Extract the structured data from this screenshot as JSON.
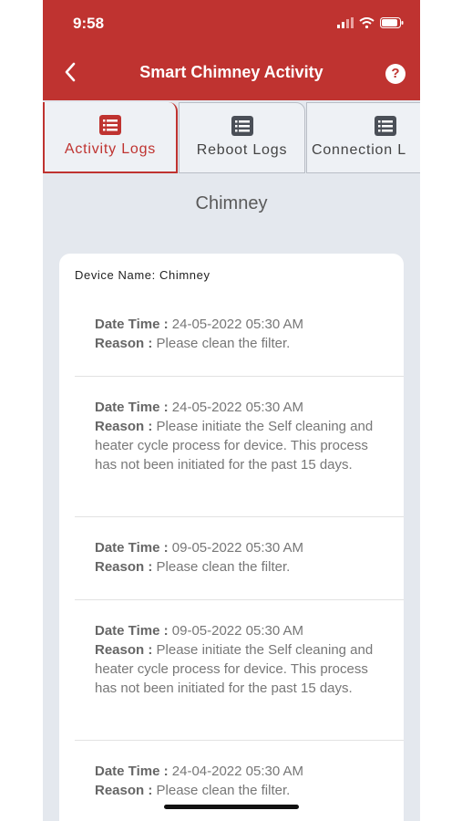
{
  "status_bar": {
    "time": "9:58"
  },
  "header": {
    "title": "Smart Chimney Activity",
    "help_label": "?"
  },
  "tabs": [
    {
      "label": "Activity Logs"
    },
    {
      "label": "Reboot Logs"
    },
    {
      "label": "Connection L"
    }
  ],
  "section_title": "Chimney",
  "device": {
    "label": "Device Name: Chimney"
  },
  "log_entries": [
    {
      "date_label": "Date Time :",
      "date": "24-05-2022 05:30 AM",
      "reason_label": "Reason :",
      "reason": "Please clean the filter."
    },
    {
      "date_label": "Date Time :",
      "date": "24-05-2022 05:30 AM",
      "reason_label": "Reason :",
      "reason": "Please initiate the Self cleaning and heater cycle process for device. This process has not been initiated for the past 15 days."
    },
    {
      "date_label": "Date Time :",
      "date": "09-05-2022 05:30 AM",
      "reason_label": "Reason :",
      "reason": "Please clean the filter."
    },
    {
      "date_label": "Date Time :",
      "date": "09-05-2022 05:30 AM",
      "reason_label": "Reason :",
      "reason": "Please initiate the Self cleaning and heater cycle process for device. This process has not been initiated for the past 15 days."
    },
    {
      "date_label": "Date Time :",
      "date": "24-04-2022 05:30 AM",
      "reason_label": "Reason :",
      "reason": "Please clean the filter."
    }
  ],
  "colors": {
    "brand": "#bf3330",
    "inactive_tab_icon": "#4a4f57"
  }
}
